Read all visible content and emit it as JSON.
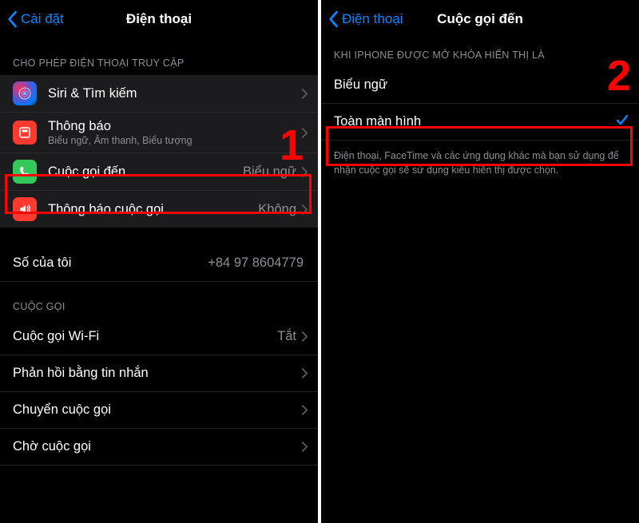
{
  "left": {
    "back": "Cài đặt",
    "title": "Điện thoại",
    "section_allow": "CHO PHÉP ĐIỆN THOẠI TRUY CẬP",
    "rows": {
      "siri": "Siri & Tìm kiếm",
      "notify": "Thông báo",
      "notify_sub": "Biểu ngữ, Âm thanh, Biểu tượng",
      "incoming": "Cuộc gọi đến",
      "incoming_val": "Biểu ngữ",
      "announce": "Thông báo cuộc gọi",
      "announce_val": "Không"
    },
    "mynum_label": "Số của tôi",
    "mynum_val": "+84 97 8604779",
    "section_calls": "CUỘC GỌI",
    "wifi_call": "Cuộc gọi Wi-Fi",
    "wifi_call_val": "Tắt",
    "reply_sms": "Phản hồi bằng tin nhắn",
    "forward": "Chuyển cuộc gọi",
    "wait": "Chờ cuộc gọi",
    "step": "1"
  },
  "right": {
    "back": "Điện thoại",
    "title": "Cuộc gọi đến",
    "section": "KHI IPHONE ĐƯỢC MỞ KHÓA HIỂN THỊ LÀ",
    "opt_banner": "Biểu ngữ",
    "opt_full": "Toàn màn hình",
    "footer": "Điện thoại, FaceTime và các ứng dụng khác mà bạn sử dụng để nhận cuộc gọi sẽ sử dụng kiểu hiển thị được chọn.",
    "step": "2"
  }
}
